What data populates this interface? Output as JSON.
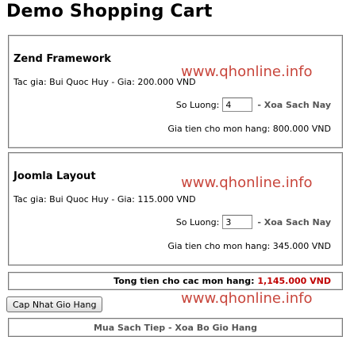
{
  "page": {
    "title": "Demo Shopping Cart"
  },
  "watermark": "www.qhonline.info",
  "items": [
    {
      "name": "Zend Framework",
      "meta": "Tac gia: Bui Quoc Huy - Gia: 200.000 VND",
      "qty_label": "So Luong:",
      "qty_value": "4",
      "delete_label": "- Xoa Sach Nay",
      "total": "Gia tien cho mon hang: 800.000 VND"
    },
    {
      "name": "Joomla Layout",
      "meta": "Tac gia: Bui Quoc Huy - Gia: 115.000 VND",
      "qty_label": "So Luong:",
      "qty_value": "3",
      "delete_label": "- Xoa Sach Nay",
      "total": "Gia tien cho mon hang: 345.000 VND"
    }
  ],
  "summary": {
    "label": "Tong tien cho cac mon hang:",
    "value": "1,145.000 VND"
  },
  "actions": {
    "update_label": "Cap Nhat Gio Hang",
    "continue_label": "Mua Sach Tiep",
    "separator": "-",
    "clear_label": "Xoa Bo Gio Hang"
  },
  "colors": {
    "watermark": "#c8463c",
    "total_value": "#c00000",
    "link": "#555555"
  }
}
